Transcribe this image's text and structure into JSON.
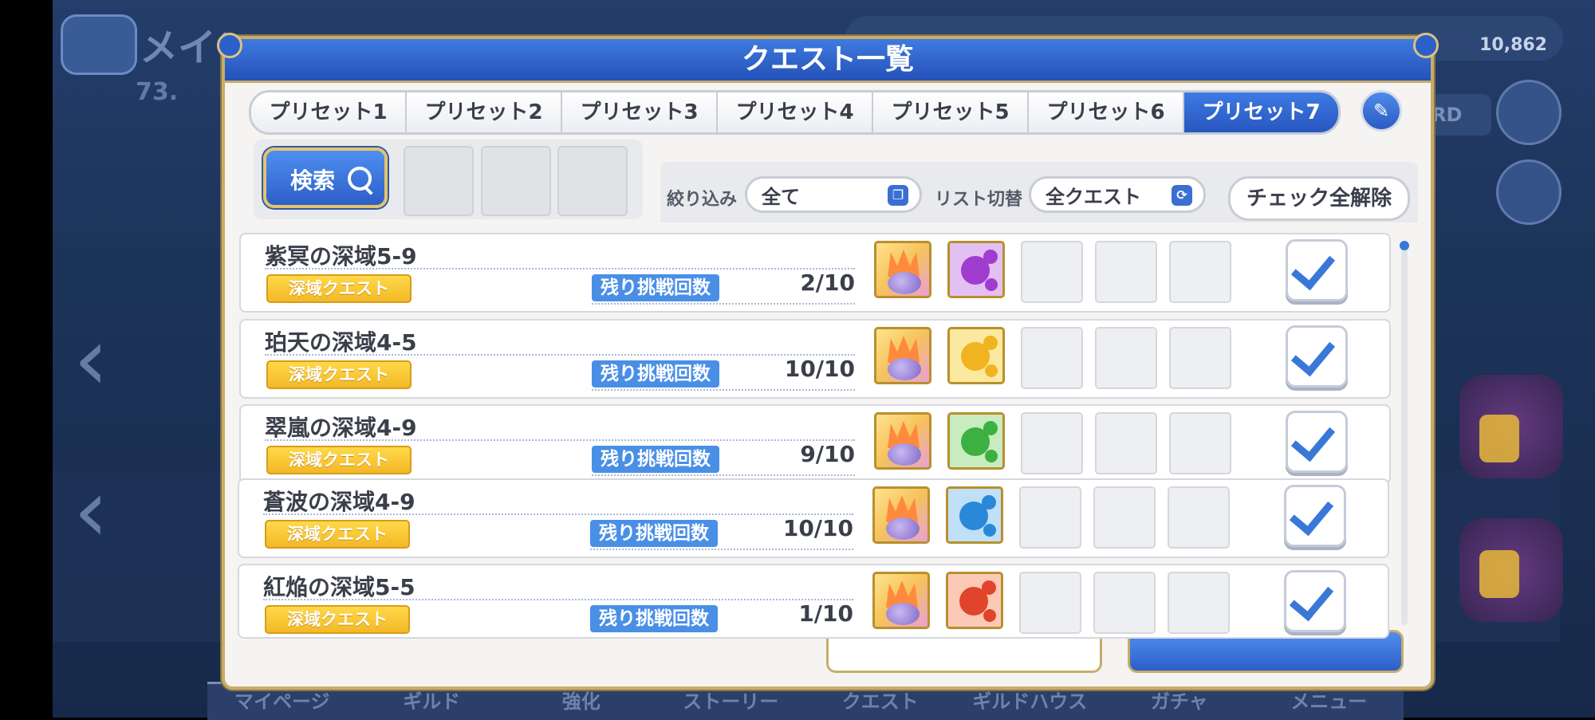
{
  "dialog": {
    "title": "クエスト一覧"
  },
  "tabs": [
    {
      "label": "プリセット1",
      "active": false
    },
    {
      "label": "プリセット2",
      "active": false
    },
    {
      "label": "プリセット3",
      "active": false
    },
    {
      "label": "プリセット4",
      "active": false
    },
    {
      "label": "プリセット5",
      "active": false
    },
    {
      "label": "プリセット6",
      "active": false
    },
    {
      "label": "プリセット7",
      "active": true
    }
  ],
  "search": {
    "button_label": "検索"
  },
  "filters": {
    "narrow_label": "絞り込み",
    "narrow_value": "全て",
    "list_label": "リスト切替",
    "list_value": "全クエスト",
    "uncheck_all_label": "チェック全解除"
  },
  "quests": [
    {
      "name": "紫冥の深域5-9",
      "tag": "深域クエスト",
      "remain_label": "残り挑戦回数",
      "remain": "2/10",
      "orb_color": "#a03cd0",
      "checked": true
    },
    {
      "name": "珀天の深域4-5",
      "tag": "深域クエスト",
      "remain_label": "残り挑戦回数",
      "remain": "10/10",
      "orb_color": "#f0b420",
      "checked": true
    },
    {
      "name": "翠嵐の深域4-9",
      "tag": "深域クエスト",
      "remain_label": "残り挑戦回数",
      "remain": "9/10",
      "orb_color": "#3cb040",
      "checked": true
    },
    {
      "name": "蒼波の深域4-9",
      "tag": "深域クエスト",
      "remain_label": "残り挑戦回数",
      "remain": "10/10",
      "orb_color": "#2a88d8",
      "checked": true
    },
    {
      "name": "紅焔の深域5-5",
      "tag": "深域クエスト",
      "remain_label": "残り挑戦回数",
      "remain": "1/10",
      "orb_color": "#e0442a",
      "checked": true
    }
  ],
  "background": {
    "money": "10,862",
    "title": "メイン",
    "subtitle": "73.",
    "nav": [
      "マイページ",
      "ギルド",
      "強化",
      "ストーリー",
      "クエスト",
      "ギルドハウス",
      "ガチャ",
      "メニュー"
    ],
    "badge": "ARD"
  },
  "colors": {
    "accent": "#2d5fc8",
    "tag": "#f3b826",
    "remain_label": "#4a8fe6",
    "frame": "#c7ac6b"
  }
}
